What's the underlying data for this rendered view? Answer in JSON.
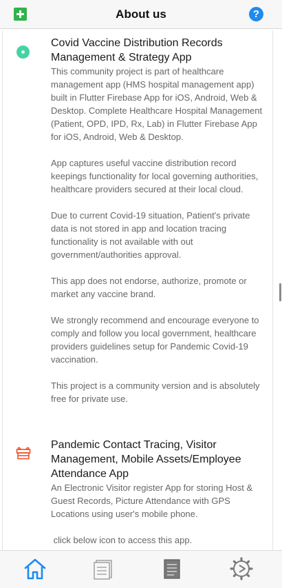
{
  "header": {
    "title": "About us",
    "help_label": "?"
  },
  "items": [
    {
      "title": "Covid Vaccine Distribution Records Management & Strategy App",
      "icon": "vaccine-icon",
      "icon_color": "#43d3a4",
      "paragraphs": [
        "This community project is part of healthcare management app (HMS hospital management app) built in Flutter Firebase App for iOS, Android, Web & Desktop. Complete Healthcare Hospital Management (Patient, OPD, IPD, Rx, Lab) in Flutter Firebase App for iOS, Android, Web & Desktop.",
        "App captures useful vaccine distribution record keepings functionality for local governing authorities, healthcare providers secured at their local cloud.",
        "Due to current Covid-19 situation, Patient's private data is not stored in app and location tracing functionality is not available with out government/authorities approval.",
        "This app does not endorse, authorize, promote or market any vaccine brand.",
        "We strongly recommend and encourage everyone to comply and follow you local government, healthcare providers guidelines setup for Pandemic Covid-19 vaccination.",
        "This project is a community version and is absolutely free for private use."
      ]
    },
    {
      "title": "Pandemic Contact Tracing, Visitor Management, Mobile Assets/Employee Attendance App",
      "icon": "gift-icon",
      "icon_color": "#e8532b",
      "paragraphs": [
        "An Electronic Visitor register App for storing Host & Guest Records, Picture Attendance with GPS Locations using user's mobile phone.",
        " click below icon to access this app."
      ]
    }
  ],
  "tabbar": {
    "tabs": [
      {
        "name": "home",
        "icon": "home-icon",
        "active": true
      },
      {
        "name": "notes",
        "icon": "notes-icon",
        "active": false
      },
      {
        "name": "records",
        "icon": "records-icon",
        "active": false
      },
      {
        "name": "settings",
        "icon": "settings-icon",
        "active": false
      }
    ]
  },
  "colors": {
    "accent": "#1e8bef",
    "add": "#2fb34a",
    "body_text": "#666666"
  }
}
